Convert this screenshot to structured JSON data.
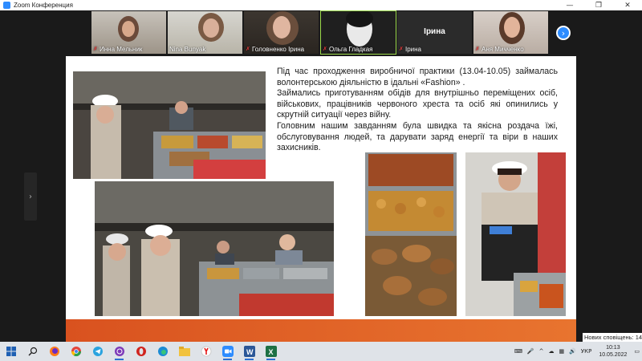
{
  "window": {
    "title": "Zoom Конференция",
    "controls": {
      "minimize": "—",
      "maximize": "❐",
      "close": "✕"
    }
  },
  "participants": [
    {
      "name": "Инна Мельник",
      "muted": true,
      "video": true
    },
    {
      "name": "Nina Bunyak",
      "muted": true,
      "video": true
    },
    {
      "name": "Головненко Ірина",
      "muted": true,
      "video": true
    },
    {
      "name": "Ольга Гладкая",
      "muted": true,
      "video": true,
      "active": true
    },
    {
      "name": "Ірина",
      "display_name": "Ірина",
      "muted": true,
      "video": false
    },
    {
      "name": "Аня Мичченко",
      "muted": true,
      "video": true
    }
  ],
  "strip": {
    "next_icon": "›"
  },
  "share": {
    "side_arrow_icon": "›",
    "slide": {
      "paragraphs": [
        "Під час проходження виробничої практики (13.04-10.05) займалась волонтерською діяльністю в ідальні «Fashion» .",
        "Займались приготуванням обідів для внутрішньо переміщених осіб, військових, працівників червоного хреста та осіб які опинились у скрутній ситуації через війну.",
        "Головним нашим завданням була швидка та якісна роздача їжі, обслуговування людей, та дарувати заряд енергії та віри в наших захисників."
      ],
      "footer_color": "#e06428"
    }
  },
  "notification": {
    "label": "Нових сповіщень: 14"
  },
  "taskbar": {
    "apps": [
      {
        "icon": "windows-start-icon"
      },
      {
        "icon": "search-icon"
      },
      {
        "icon": "firefox-icon"
      },
      {
        "icon": "chrome-icon"
      },
      {
        "icon": "telegram-icon"
      },
      {
        "icon": "viber-icon"
      },
      {
        "icon": "opera-icon"
      },
      {
        "icon": "edge-icon"
      },
      {
        "icon": "file-explorer-icon"
      },
      {
        "icon": "yandex-icon"
      },
      {
        "icon": "zoom-icon"
      },
      {
        "icon": "word-icon"
      },
      {
        "icon": "excel-icon"
      }
    ],
    "tray": {
      "language": "УКР",
      "time": "10:13",
      "date": "10.05.2022"
    }
  }
}
